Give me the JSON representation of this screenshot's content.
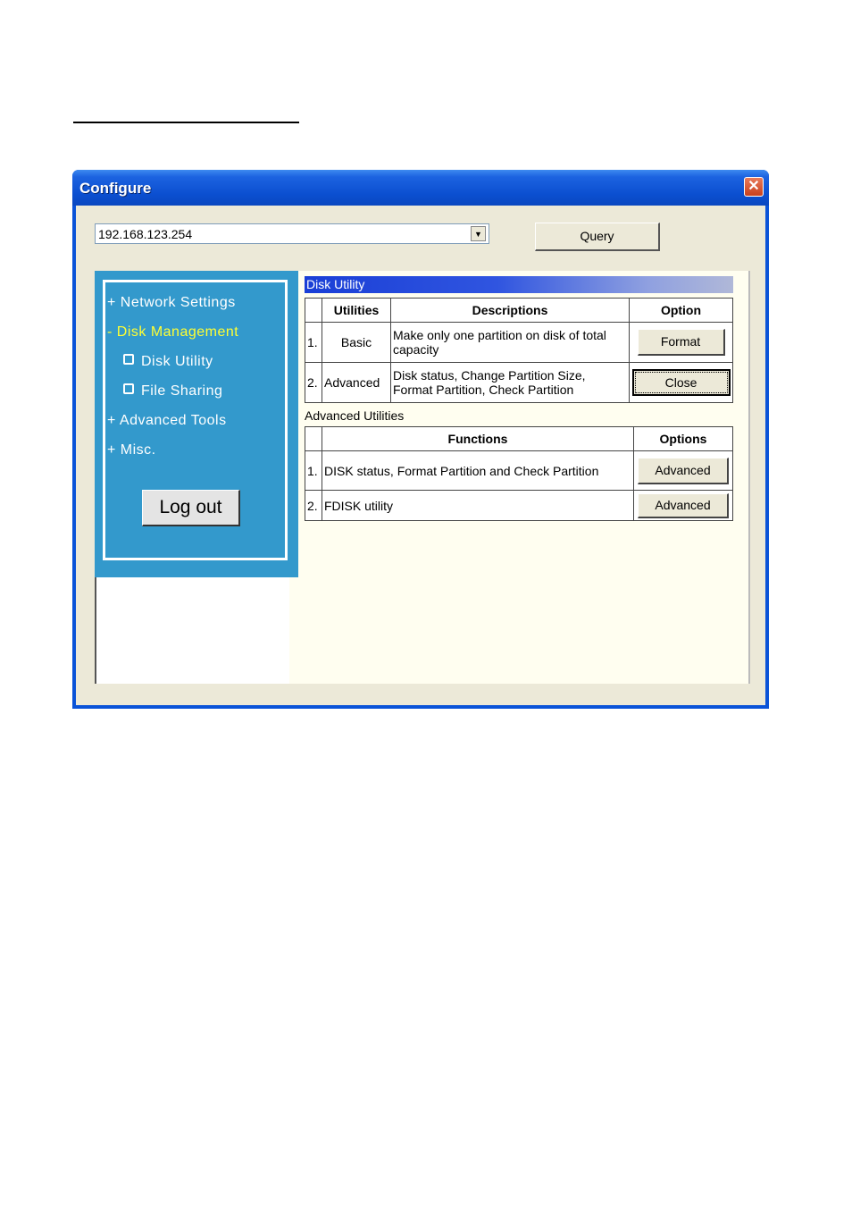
{
  "window": {
    "title": "Configure",
    "close_glyph": "✕"
  },
  "toolbar": {
    "ip_value": "192.168.123.254",
    "dropdown_glyph": "▼",
    "query_label": "Query"
  },
  "sidebar": {
    "items": [
      {
        "label": "+ Network Settings"
      },
      {
        "label": "- Disk Management"
      },
      {
        "label": "Disk Utility"
      },
      {
        "label": "File Sharing"
      },
      {
        "label": "+ Advanced Tools"
      },
      {
        "label": "+ Misc."
      }
    ],
    "logout_label": "Log out"
  },
  "disk_utility": {
    "header": "Disk Utility",
    "columns": [
      "Utilities",
      "Descriptions",
      "Option"
    ],
    "rows": [
      {
        "num": "1.",
        "utility": "Basic",
        "description": "Make only one partition on disk of total capacity",
        "button": "Format"
      },
      {
        "num": "2.",
        "utility": "Advanced",
        "description": "Disk status, Change Partition Size, Format Partition, Check Partition",
        "button": "Close"
      }
    ]
  },
  "advanced_utilities": {
    "label": "Advanced Utilities",
    "columns": [
      "Functions",
      "Options"
    ],
    "rows": [
      {
        "num": "1.",
        "function": "DISK status, Format Partition and Check Partition",
        "button": "Advanced"
      },
      {
        "num": "2.",
        "function": "FDISK utility",
        "button": "Advanced"
      }
    ]
  },
  "colors": {
    "sidebar_bg": "#3399cc",
    "active_nav": "#ffff33",
    "titlebar": "#0b4fd0"
  }
}
